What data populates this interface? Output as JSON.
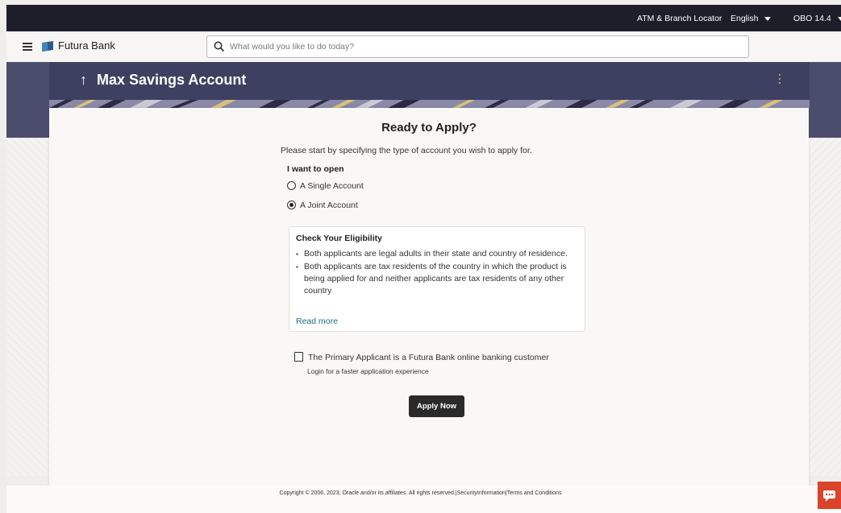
{
  "topbar": {
    "atm_locator": "ATM & Branch Locator",
    "language": "English",
    "version": "OBO 14.4"
  },
  "navbar": {
    "brand": "Futura Bank",
    "search_placeholder": "What would you like to do today?"
  },
  "hero": {
    "title": "Max Savings Account",
    "back_icon": "↑"
  },
  "card": {
    "heading": "Ready to Apply?",
    "intro": "Please start by specifying the type of account you wish to apply for.",
    "want_label": "I want to open",
    "options": [
      {
        "label": "A Single Account",
        "checked": false
      },
      {
        "label": "A Joint Account",
        "checked": true
      }
    ],
    "eligibility": {
      "title": "Check Your Eligibility",
      "items": [
        "Both applicants are legal adults in their state and country of residence.",
        "Both applicants are tax residents of the country in which the product is being applied for and neither applicants are tax residents of any other country"
      ],
      "read_more": "Read more"
    },
    "primary_customer_label": "The Primary Applicant is a Futura Bank online banking customer",
    "login_hint": "Login for a faster application experience",
    "apply_button": "Apply Now"
  },
  "footer": {
    "copyright": "Copyright © 2006, 2023, Oracle and/or its affiliates. All rights reserved.|SecurityInformation|Terms and Conditions"
  },
  "colors": {
    "topbar_bg": "#1d1e2a",
    "hero_bg": "#4b4d6d",
    "link": "#1a6f84",
    "button_bg": "#2a2a2a",
    "chat_bg": "#d9442a"
  },
  "icons": {
    "menu": "hamburger-icon",
    "logo": "futura-bank-logo-icon",
    "search": "search-icon",
    "back": "back-arrow-icon",
    "more": "kebab-menu-icon",
    "chat": "chat-icon"
  }
}
